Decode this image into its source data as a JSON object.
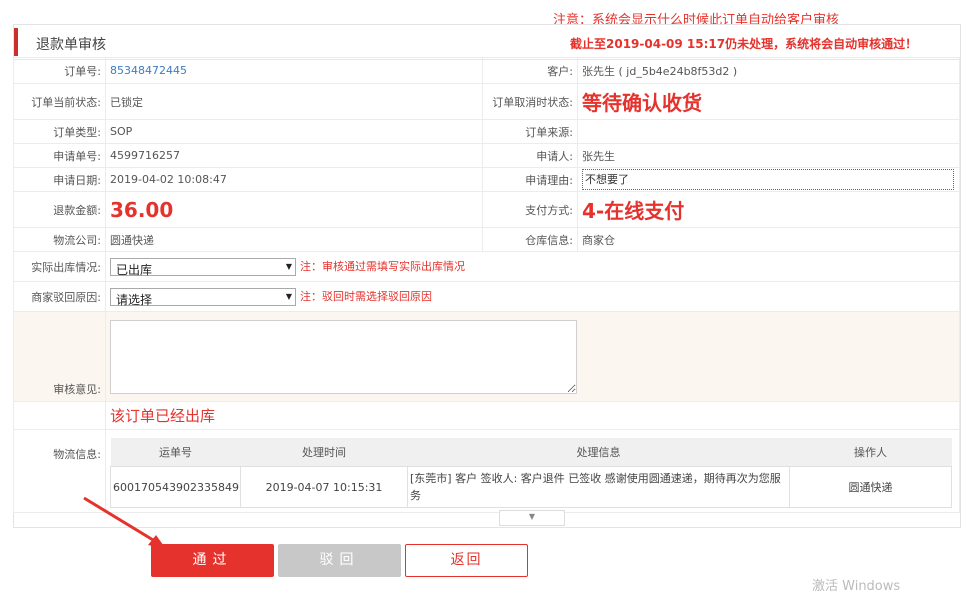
{
  "notes": {
    "top": "注意：系统会显示什么时候此订单自动给客户审核",
    "auto": "截止至2019-04-09 15:17仍未处理，系统将会自动审核通过！"
  },
  "panel": {
    "title": "退款单审核"
  },
  "fields": {
    "order_no_label": "订单号:",
    "order_no": "85348472445",
    "customer_label": "客户:",
    "customer": "张先生 ( jd_5b4e24b8f53d2 )",
    "order_status_label": "订单当前状态:",
    "order_status": "已锁定",
    "cancel_status_label": "订单取消时状态:",
    "cancel_status": "等待确认收货",
    "order_type_label": "订单类型:",
    "order_type": "SOP",
    "order_source_label": "订单来源:",
    "order_source": "",
    "apply_no_label": "申请单号:",
    "apply_no": "4599716257",
    "applicant_label": "申请人:",
    "applicant": "张先生",
    "apply_date_label": "申请日期:",
    "apply_date": "2019-04-02 10:08:47",
    "reason_label": "申请理由:",
    "reason": "不想要了",
    "refund_label": "退款金额:",
    "refund": "36.00",
    "pay_label": "支付方式:",
    "pay": "4-在线支付",
    "logistics_co_label": "物流公司:",
    "logistics_co": "圆通快递",
    "warehouse_label": "仓库信息:",
    "warehouse": "商家仓",
    "outbound_label": "实际出库情况:",
    "outbound_selected": "已出库",
    "outbound_note": "注：审核通过需填写实际出库情况",
    "reject_reason_label": "商家驳回原因:",
    "reject_reason_selected": "请选择",
    "reject_note": "注：驳回时需选择驳回原因",
    "review_label": "审核意见:",
    "review_text": "",
    "shipped_notice": "该订单已经出库",
    "logistics_info_label": "物流信息:"
  },
  "logistics_table": {
    "headers": [
      "运单号",
      "处理时间",
      "处理信息",
      "操作人"
    ],
    "rows": [
      [
        "600170543902335849",
        "2019-04-07 10:15:31",
        "[东莞市] 客户 签收人: 客户退件 已签收 感谢使用圆通速递，期待再次为您服务",
        "圆通快递"
      ]
    ]
  },
  "buttons": {
    "pass": "通过",
    "reject": "驳回",
    "back": "返回"
  },
  "watermark": "激活 Windows",
  "colors": {
    "accent": "#e5322d",
    "link": "#3a7cc5",
    "disabled": "#c8c8c8"
  }
}
